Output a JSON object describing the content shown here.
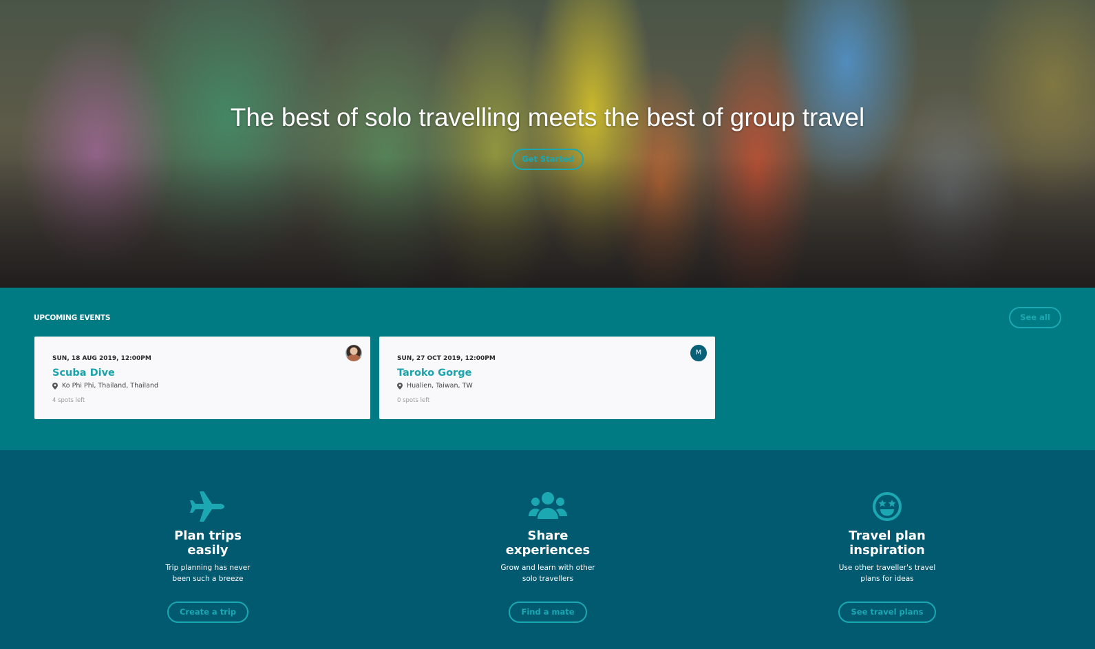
{
  "hero": {
    "title": "The best of solo travelling meets the best of group travel",
    "cta_label": "Get Started"
  },
  "events": {
    "heading": "UPCOMING EVENTS",
    "see_all_label": "See all",
    "items": [
      {
        "date": "SUN, 18 AUG 2019, 12:00PM",
        "title": "Scuba Dive",
        "location": "Ko Phi Phi, Thailand, Thailand",
        "spots": "4 spots left",
        "avatar": "photo"
      },
      {
        "date": "SUN, 27 OCT 2019, 12:00PM",
        "title": "Taroko Gorge",
        "location": "Hualien, Taiwan, TW",
        "spots": "0 spots left",
        "avatar": "M"
      }
    ]
  },
  "features": [
    {
      "icon": "plane-icon",
      "title": "Plan trips easily",
      "description": "Trip planning has never been such a breeze",
      "button_label": "Create a trip"
    },
    {
      "icon": "users-icon",
      "title": "Share experiences",
      "description": "Grow and learn with other solo travellers",
      "button_label": "Find a mate"
    },
    {
      "icon": "smiley-icon",
      "title": "Travel plan inspiration",
      "description": "Use other traveller's travel plans for ideas",
      "button_label": "See travel plans"
    }
  ],
  "colors": {
    "accent": "#1ba8b3",
    "events_bg": "#017b83",
    "features_bg": "#015a70",
    "card_bg": "#f9f9fb"
  }
}
